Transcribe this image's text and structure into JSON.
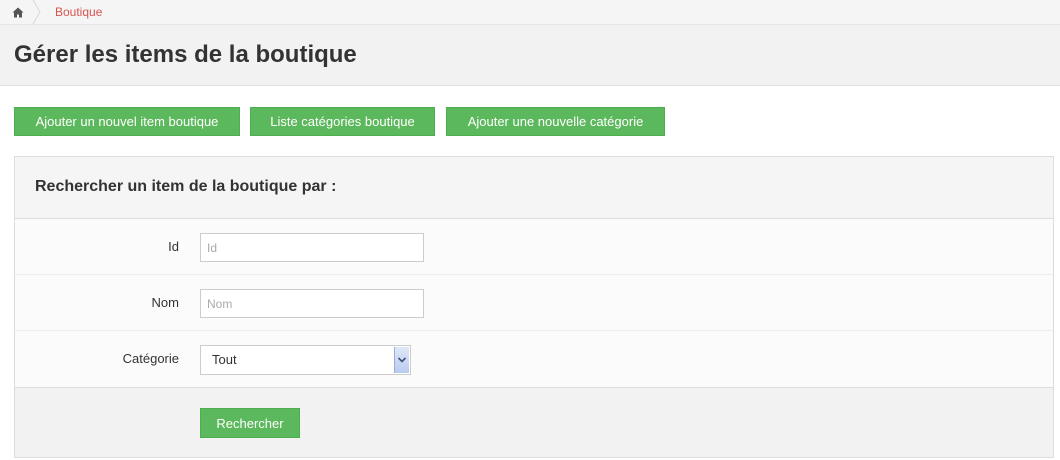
{
  "breadcrumb": {
    "home_icon": "home-icon",
    "items": [
      {
        "label": "Boutique"
      }
    ],
    "link_color": "#d9534f"
  },
  "page": {
    "title": "Gérer les items de la boutique"
  },
  "actions": {
    "add_item_label": "Ajouter un nouvel item boutique",
    "list_categories_label": "Liste catégories boutique",
    "add_category_label": "Ajouter une nouvelle catégorie",
    "button_color": "#5cb85c"
  },
  "search": {
    "title": "Rechercher un item de la boutique par :",
    "fields": {
      "id": {
        "label": "Id",
        "placeholder": "Id",
        "value": ""
      },
      "name": {
        "label": "Nom",
        "placeholder": "Nom",
        "value": ""
      },
      "category": {
        "label": "Catégorie",
        "selected": "Tout",
        "icon": "chevron-down-icon"
      }
    },
    "submit_label": "Rechercher"
  }
}
